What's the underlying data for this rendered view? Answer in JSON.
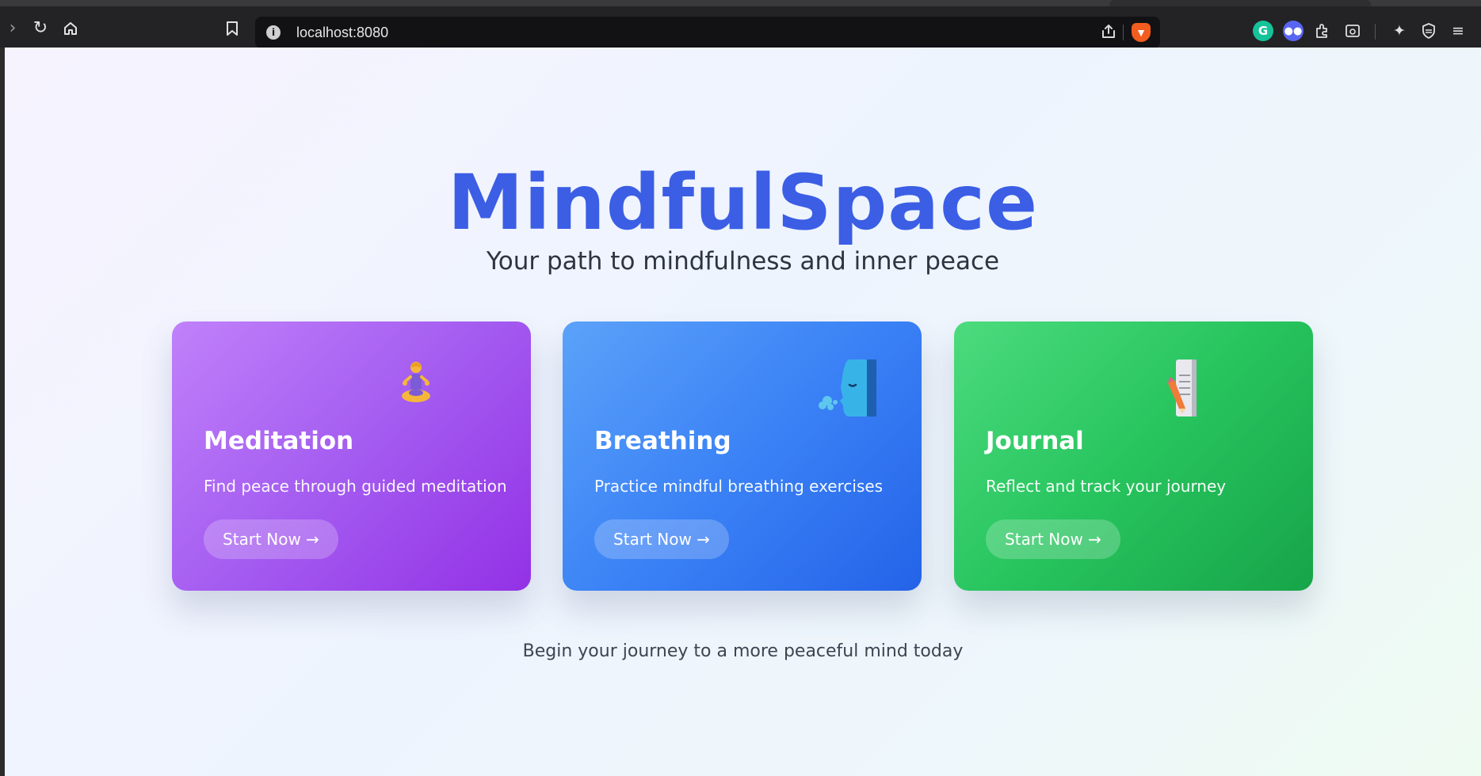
{
  "browser": {
    "url": "localhost:8080",
    "nav_icons": [
      "forward-icon",
      "reload-icon",
      "home-icon",
      "bookmark-icon"
    ],
    "extension_icons": [
      "grammarly-icon",
      "discord-icon",
      "extensions-icon",
      "reader-icon",
      "leo-ai-icon",
      "brave-vpn-icon",
      "menu-icon"
    ]
  },
  "hero": {
    "title": "MindfulSpace",
    "tagline": "Your path to mindfulness and inner peace"
  },
  "cards": [
    {
      "title": "Meditation",
      "description": "Find peace through guided meditation",
      "button": "Start Now →",
      "icon": "meditating-person-icon",
      "color": "#a855f7"
    },
    {
      "title": "Breathing",
      "description": "Practice mindful breathing exercises",
      "button": "Start Now →",
      "icon": "face-exhaling-icon",
      "color": "#3b82f6"
    },
    {
      "title": "Journal",
      "description": "Reflect and track your journey",
      "button": "Start Now →",
      "icon": "notebook-pencil-icon",
      "color": "#22c55e"
    }
  ],
  "footer": {
    "text": "Begin your journey to a more peaceful mind today"
  },
  "colors": {
    "brand": "#3b5ee5",
    "page_background": "#eef4fe"
  }
}
